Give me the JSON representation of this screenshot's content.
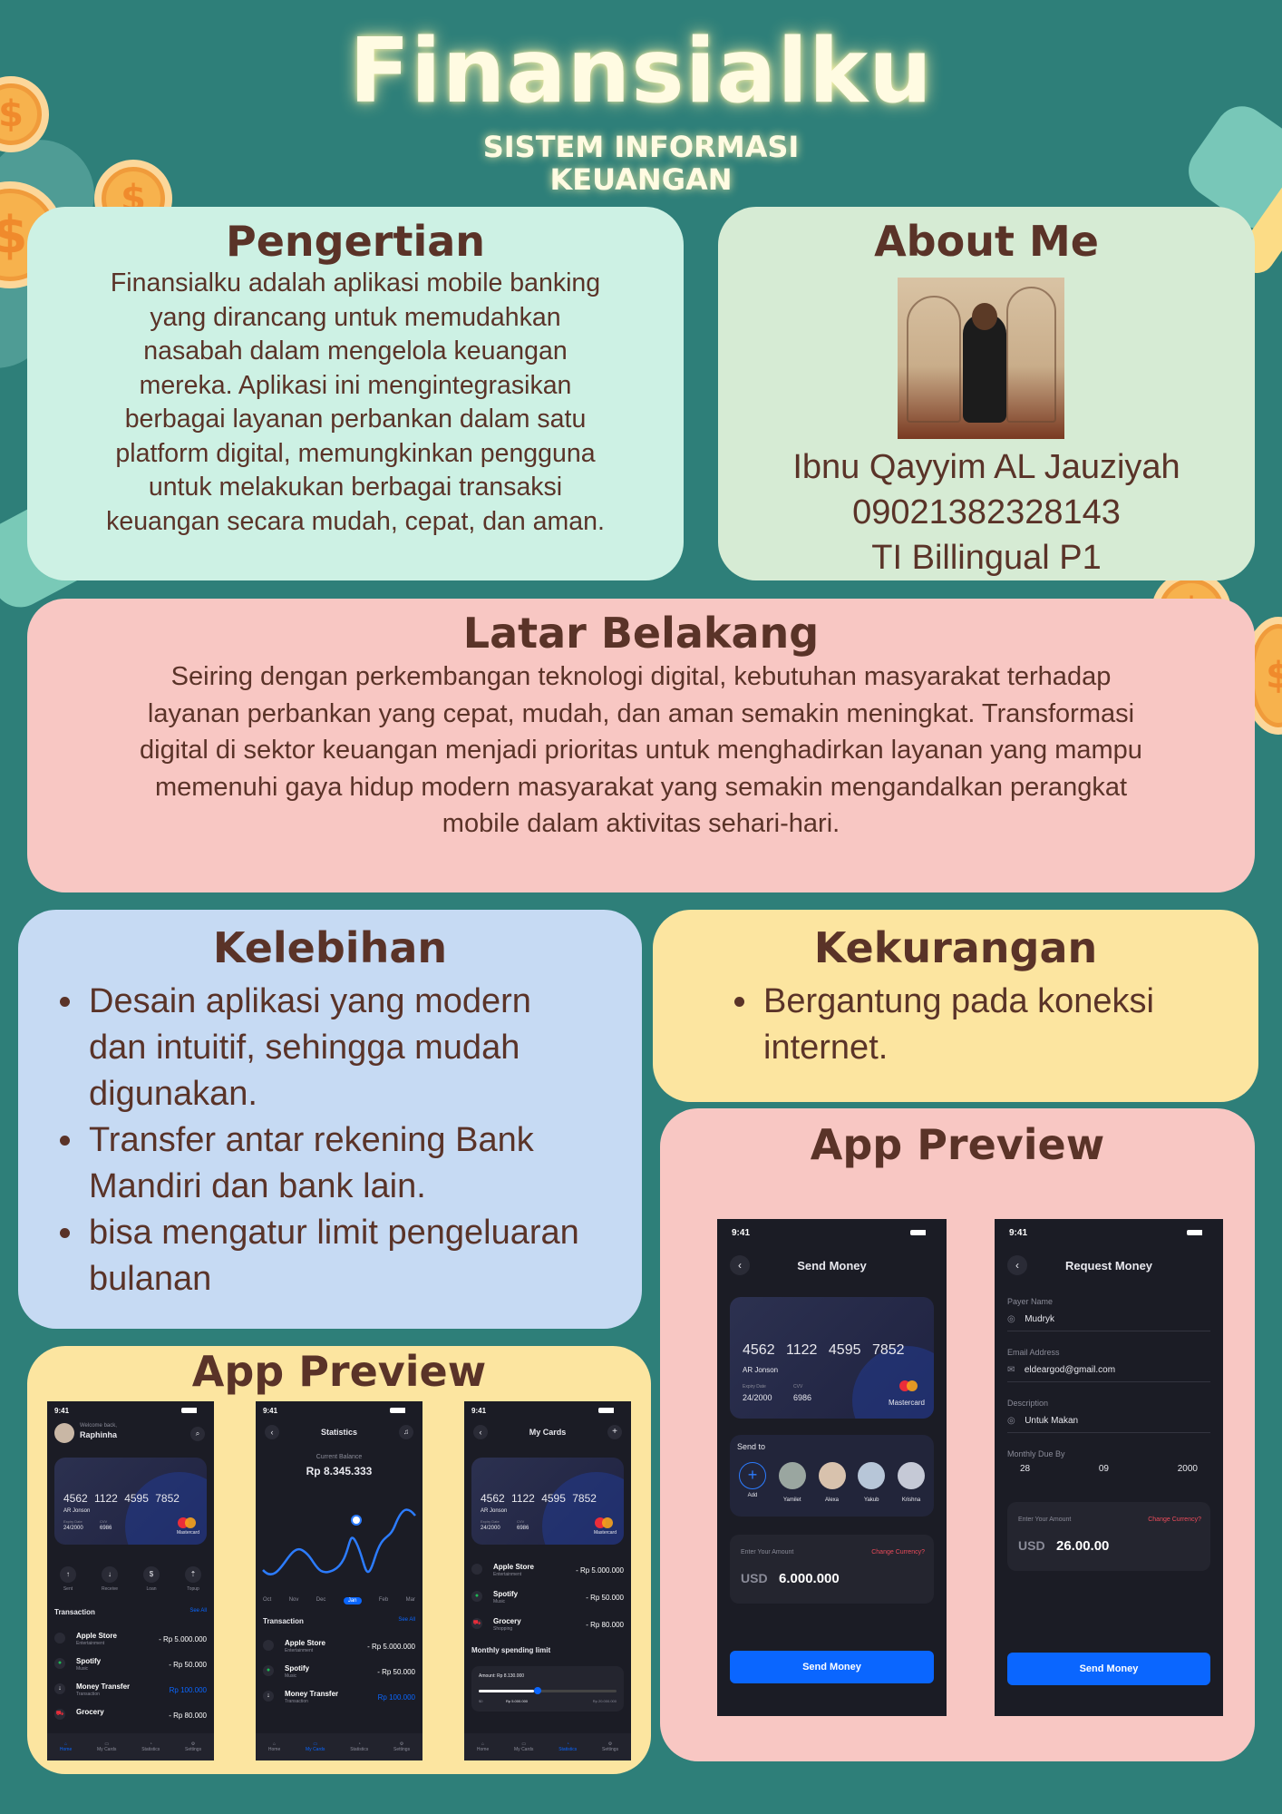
{
  "header": {
    "title": "Finansialku",
    "subtitle_line1": "SISTEM INFORMASI",
    "subtitle_line2": "KEUANGAN"
  },
  "pengertian": {
    "heading": "Pengertian",
    "lines": [
      "Finansialku adalah aplikasi mobile banking",
      "yang dirancang untuk memudahkan",
      "nasabah dalam mengelola keuangan",
      "mereka. Aplikasi ini mengintegrasikan",
      "berbagai layanan perbankan dalam satu",
      "platform digital, memungkinkan pengguna",
      "untuk melakukan berbagai transaksi",
      "keuangan secara mudah, cepat, dan aman."
    ]
  },
  "about": {
    "heading": "About Me",
    "name": "Ibnu Qayyim AL Jauziyah",
    "id": "09021382328143",
    "class": "TI Billingual P1"
  },
  "latar": {
    "heading": "Latar Belakang",
    "lines": [
      "Seiring dengan perkembangan teknologi digital, kebutuhan masyarakat terhadap",
      "layanan perbankan yang cepat, mudah, dan aman semakin meningkat. Transformasi",
      "digital di sektor keuangan menjadi prioritas untuk menghadirkan layanan yang mampu",
      "memenuhi gaya hidup modern masyarakat yang semakin mengandalkan perangkat",
      "mobile dalam aktivitas sehari-hari."
    ]
  },
  "kelebihan": {
    "heading": "Kelebihan",
    "items": [
      {
        "l1": "Desain aplikasi yang modern",
        "l2": "dan intuitif, sehingga mudah",
        "l3": "digunakan."
      },
      {
        "l1": "Transfer antar rekening Bank",
        "l2": "Mandiri dan bank lain."
      },
      {
        "l1": "bisa mengatur limit pengeluaran",
        "l2": "bulanan"
      }
    ]
  },
  "kekurangan": {
    "heading": "Kekurangan",
    "items": [
      {
        "l1": "Bergantung pada koneksi",
        "l2": "internet."
      }
    ]
  },
  "preview_left": {
    "heading": "App Preview"
  },
  "preview_right": {
    "heading": "App Preview"
  },
  "coins": {
    "symbol": "$"
  },
  "phone_home": {
    "time": "9:41",
    "welcome": "Welcome back,",
    "user": "Raphinha",
    "card_number": [
      "4562",
      "1122",
      "4595",
      "7852"
    ],
    "card_name": "AR Jonson",
    "expiry_label": "Expiry Date",
    "expiry": "24/2000",
    "cvv_label": "CVV",
    "cvv": "6986",
    "brand": "Mastercard",
    "actions": [
      "Sent",
      "Receive",
      "Loan",
      "Topup"
    ],
    "section": "Transaction",
    "see_all": "See All",
    "tx": [
      {
        "name": "Apple Store",
        "sub": "Entertainment",
        "amount": "- Rp 5.000.000"
      },
      {
        "name": "Spotify",
        "sub": "Music",
        "amount": "- Rp 50.000"
      },
      {
        "name": "Money Transfer",
        "sub": "Transaction",
        "amount": "Rp 100.000"
      },
      {
        "name": "Grocery",
        "sub": "",
        "amount": "- Rp 80.000"
      }
    ],
    "nav": [
      "Home",
      "My Cards",
      "Statistics",
      "Settings"
    ]
  },
  "phone_stats": {
    "time": "9:41",
    "title": "Statistics",
    "balance_label": "Current Balance",
    "balance": "Rp 8.345.333",
    "months": [
      "Oct",
      "Nov",
      "Dec",
      "Jan",
      "Feb",
      "Mar"
    ],
    "section": "Transaction",
    "see_all": "See All",
    "tx": [
      {
        "name": "Apple Store",
        "sub": "Entertainment",
        "amount": "- Rp 5.000.000"
      },
      {
        "name": "Spotify",
        "sub": "Music",
        "amount": "- Rp 50.000"
      },
      {
        "name": "Money Transfer",
        "sub": "Transaction",
        "amount": "Rp 100.000"
      }
    ],
    "nav": [
      "Home",
      "My Cards",
      "Statistics",
      "Settings"
    ]
  },
  "phone_cards": {
    "time": "9:41",
    "title": "My Cards",
    "card_number": [
      "4562",
      "1122",
      "4595",
      "7852"
    ],
    "card_name": "AR Jonson",
    "expiry_label": "Expiry Date",
    "expiry": "24/2000",
    "cvv_label": "CVV",
    "cvv": "6986",
    "brand": "Mastercard",
    "tx": [
      {
        "name": "Apple Store",
        "sub": "Entertainment",
        "amount": "- Rp 5.000.000"
      },
      {
        "name": "Spotify",
        "sub": "Music",
        "amount": "- Rp 50.000"
      },
      {
        "name": "Grocery",
        "sub": "Shopping",
        "amount": "- Rp 80.000"
      }
    ],
    "limit_title": "Monthly spending limit",
    "limit_amount": "Amount: Rp 8.130.000",
    "limit_min": "$0",
    "limit_mid": "Rp 5.000.000",
    "limit_max": "Rp 20.000.000",
    "nav": [
      "Home",
      "My Cards",
      "Statistics",
      "Settings"
    ]
  },
  "phone_send": {
    "time": "9:41",
    "title": "Send Money",
    "card_number": [
      "4562",
      "1122",
      "4595",
      "7852"
    ],
    "card_name": "AR Jonson",
    "expiry_label": "Expiry Date",
    "expiry": "24/2000",
    "cvv_label": "CVV",
    "cvv": "6986",
    "brand": "Mastercard",
    "send_to": "Send to",
    "contacts": [
      "Add",
      "Yamilet",
      "Alexa",
      "Yakub",
      "Krishna"
    ],
    "amount_label": "Enter Your Amount",
    "change": "Change Currency?",
    "currency": "USD",
    "amount": "6.000.000",
    "button": "Send Money"
  },
  "phone_request": {
    "time": "9:41",
    "title": "Request Money",
    "payer_label": "Payer Name",
    "payer": "Mudryk",
    "email_label": "Email Address",
    "email": "eldeargod@gmail.com",
    "desc_label": "Description",
    "desc": "Untuk Makan",
    "due_label": "Monthly Due By",
    "due": [
      "28",
      "09",
      "2000"
    ],
    "amount_label": "Enter Your Amount",
    "change": "Change Currency?",
    "currency": "USD",
    "amount": "26.00.00",
    "button": "Send Money"
  }
}
